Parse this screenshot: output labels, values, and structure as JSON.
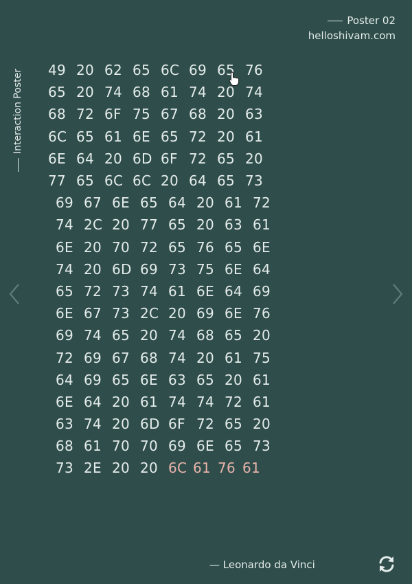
{
  "header": {
    "poster_label": "Poster 02",
    "site": "helloshivam.com"
  },
  "side_title": "Interaction Poster",
  "hex_rows": [
    {
      "cells": [
        "49",
        "20",
        "62",
        "65",
        "6C",
        "69",
        "65",
        "76"
      ],
      "indent": 0
    },
    {
      "cells": [
        "65",
        "20",
        "74",
        "68",
        "61",
        "74",
        "20",
        "74"
      ],
      "indent": 0
    },
    {
      "cells": [
        "68",
        "72",
        "6F",
        "75",
        "67",
        "68",
        "20",
        "63"
      ],
      "indent": 0
    },
    {
      "cells": [
        "6C",
        "65",
        "61",
        "6E",
        "65",
        "72",
        "20",
        "61"
      ],
      "indent": 0
    },
    {
      "cells": [
        "6E",
        "64",
        "20",
        "6D",
        "6F",
        "72",
        "65",
        "20"
      ],
      "indent": 0
    },
    {
      "cells": [
        "77",
        "65",
        "6C",
        "6C",
        "20",
        "64",
        "65",
        "73"
      ],
      "indent": 0
    },
    {
      "cells": [
        "69",
        "67",
        "6E",
        "65",
        "64",
        "20",
        "61",
        "72"
      ],
      "indent": 1
    },
    {
      "cells": [
        "74",
        "2C",
        "20",
        "77",
        "65",
        "20",
        "63",
        "61"
      ],
      "indent": 1
    },
    {
      "cells": [
        "6E",
        "20",
        "70",
        "72",
        "65",
        "76",
        "65",
        "6E"
      ],
      "indent": 1
    },
    {
      "cells": [
        "74",
        "20",
        "6D",
        "69",
        "73",
        "75",
        "6E",
        "64"
      ],
      "indent": 1
    },
    {
      "cells": [
        "65",
        "72",
        "73",
        "74",
        "61",
        "6E",
        "64",
        "69"
      ],
      "indent": 1
    },
    {
      "cells": [
        "6E",
        "67",
        "73",
        "2C",
        "20",
        "69",
        "6E",
        "76"
      ],
      "indent": 1
    },
    {
      "cells": [
        "69",
        "74",
        "65",
        "20",
        "74",
        "68",
        "65",
        "20"
      ],
      "indent": 1
    },
    {
      "cells": [
        "72",
        "69",
        "67",
        "68",
        "74",
        "20",
        "61",
        "75"
      ],
      "indent": 1
    },
    {
      "cells": [
        "64",
        "69",
        "65",
        "6E",
        "63",
        "65",
        "20",
        "61"
      ],
      "indent": 1
    },
    {
      "cells": [
        "6E",
        "64",
        "20",
        "61",
        "74",
        "74",
        "72",
        "61"
      ],
      "indent": 1
    },
    {
      "cells": [
        "63",
        "74",
        "20",
        "6D",
        "6F",
        "72",
        "65",
        "20"
      ],
      "indent": 1
    },
    {
      "cells": [
        "68",
        "61",
        "70",
        "70",
        "69",
        "6E",
        "65",
        "73"
      ],
      "indent": 1
    },
    {
      "cells": [
        "73",
        "2E",
        "20",
        "20"
      ],
      "highlight": [
        "6C",
        "61",
        "76",
        "61"
      ],
      "indent": 1
    }
  ],
  "quote": "— Leonardo da Vinci",
  "icons": {
    "prev": "chevron-left-icon",
    "next": "chevron-right-icon",
    "refresh": "refresh-icon",
    "cursor": "hand-pointer-icon"
  },
  "colors": {
    "background": "#2e4d4b",
    "text": "#e4ecea",
    "highlight": "#e8b4aa",
    "arrow": "#5f7e7b"
  }
}
